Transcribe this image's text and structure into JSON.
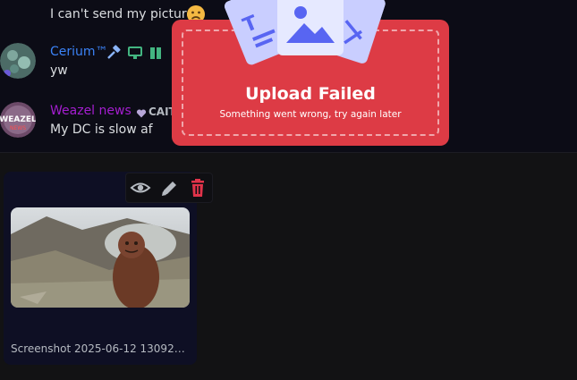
{
  "chat": {
    "messages": [
      {
        "text": "I can't send my picture"
      },
      {
        "username": "Cerium™",
        "username_color": "#3b82f6",
        "text": "yw",
        "text_color": "#e0334a"
      },
      {
        "username": "Weazel news",
        "username_color": "#a41ecf",
        "tag": "CAIT",
        "text": "My DC is slow af"
      }
    ]
  },
  "attachment": {
    "filename": "Screenshot 2025-06-12 130928...",
    "actions": {
      "view": "eye-icon",
      "edit": "pencil-icon",
      "delete": "trash-icon"
    }
  },
  "upload_error": {
    "title": "Upload Failed",
    "subtitle": "Something went wrong, try again later",
    "accent": "#dd3b45"
  },
  "colors": {
    "background": "#121214",
    "chat_bg": "#0c0c16",
    "icon_blue": "#5865f2"
  }
}
